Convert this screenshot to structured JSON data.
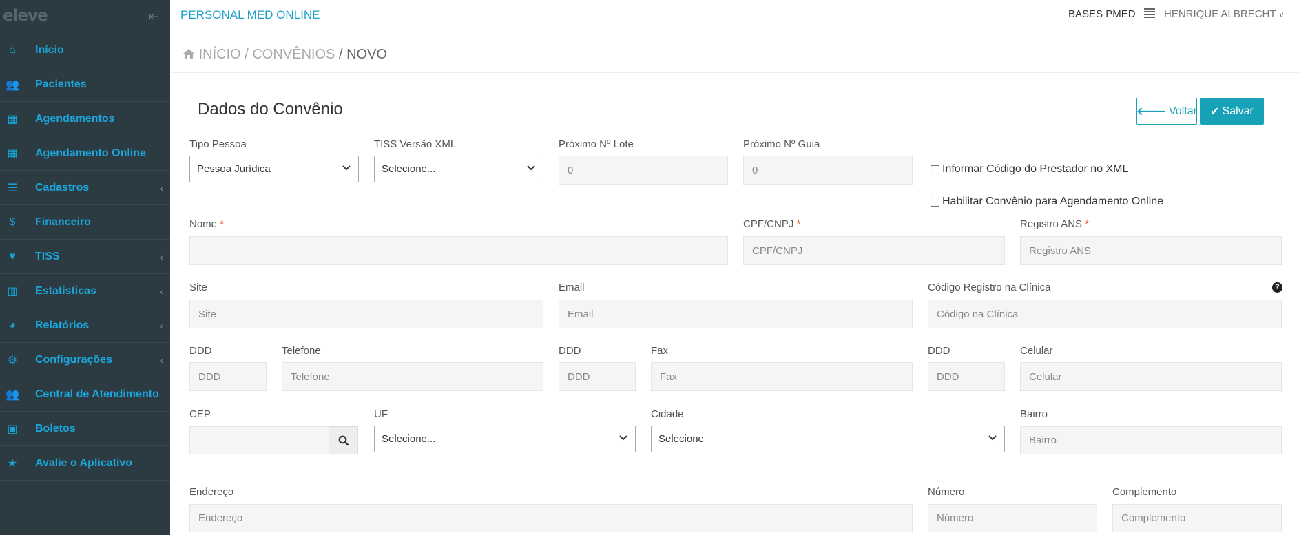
{
  "app": {
    "logo": "eleve",
    "brand": "PERSONAL MED ONLINE",
    "bases": "BASES PMED",
    "user": "HENRIQUE ALBRECHT"
  },
  "sidebar": {
    "items": [
      {
        "label": "Início",
        "icon": "home-icon",
        "caret": false
      },
      {
        "label": "Pacientes",
        "icon": "users-icon",
        "caret": false
      },
      {
        "label": "Agendamentos",
        "icon": "calendar-icon",
        "caret": false
      },
      {
        "label": "Agendamento Online",
        "icon": "calendar-icon",
        "caret": false
      },
      {
        "label": "Cadastros",
        "icon": "list-icon",
        "caret": true
      },
      {
        "label": "Financeiro",
        "icon": "dollar-icon",
        "caret": false
      },
      {
        "label": "TISS",
        "icon": "heartbeat-icon",
        "caret": true
      },
      {
        "label": "Estatísticas",
        "icon": "bar-chart-icon",
        "caret": true
      },
      {
        "label": "Relatórios",
        "icon": "pie-chart-icon",
        "caret": true
      },
      {
        "label": "Configurações",
        "icon": "gear-icon",
        "caret": true
      },
      {
        "label": "Central de Atendimento",
        "icon": "users-icon",
        "caret": false
      },
      {
        "label": "Boletos",
        "icon": "money-icon",
        "caret": false
      },
      {
        "label": "Avalie o Aplicativo",
        "icon": "star-icon",
        "caret": false
      }
    ]
  },
  "breadcrumb": {
    "home": "INÍCIO",
    "section": "/ CONVÊNIOS",
    "current": "/ NOVO"
  },
  "page": {
    "title": "Dados do Convênio",
    "back": "Voltar",
    "save": "Salvar"
  },
  "form": {
    "tipo_pessoa": {
      "label": "Tipo Pessoa",
      "value": "Pessoa Jurídica"
    },
    "tiss": {
      "label": "TISS Versão XML",
      "value": "Selecione..."
    },
    "lote": {
      "label": "Próximo Nº Lote",
      "value": "0"
    },
    "guia": {
      "label": "Próximo Nº Guia",
      "value": "0"
    },
    "chk_prestador": "Informar Código do Prestador no XML",
    "chk_online": "Habilitar Convênio para Agendamento Online",
    "nome": {
      "label": "Nome",
      "placeholder": ""
    },
    "cpf": {
      "label": "CPF/CNPJ",
      "placeholder": "CPF/CNPJ"
    },
    "ans": {
      "label": "Registro ANS",
      "placeholder": "Registro ANS"
    },
    "site": {
      "label": "Site",
      "placeholder": "Site"
    },
    "email": {
      "label": "Email",
      "placeholder": "Email"
    },
    "codigo": {
      "label": "Código Registro na Clínica",
      "placeholder": "Código na Clínica"
    },
    "ddd1": {
      "label": "DDD",
      "placeholder": "DDD"
    },
    "telefone": {
      "label": "Telefone",
      "placeholder": "Telefone"
    },
    "ddd2": {
      "label": "DDD",
      "placeholder": "DDD"
    },
    "fax": {
      "label": "Fax",
      "placeholder": "Fax"
    },
    "ddd3": {
      "label": "DDD",
      "placeholder": "DDD"
    },
    "celular": {
      "label": "Celular",
      "placeholder": "Celular"
    },
    "cep": {
      "label": "CEP",
      "placeholder": ""
    },
    "uf": {
      "label": "UF",
      "value": "Selecione..."
    },
    "cidade": {
      "label": "Cidade",
      "value": "Selecione"
    },
    "bairro": {
      "label": "Bairro",
      "placeholder": "Bairro"
    },
    "endereco": {
      "label": "Endereço",
      "placeholder": "Endereço"
    },
    "numero": {
      "label": "Número",
      "placeholder": "Número"
    },
    "complemento": {
      "label": "Complemento",
      "placeholder": "Complemento"
    }
  }
}
